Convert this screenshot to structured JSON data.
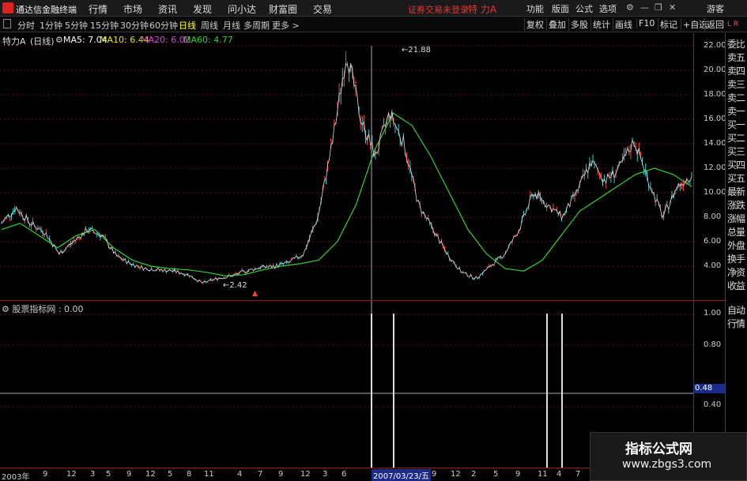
{
  "app": {
    "title": "通达信金融终端",
    "menus": [
      "行情",
      "市场",
      "资讯",
      "发现",
      "问小达",
      "财富圈",
      "交易"
    ],
    "login_status": "证券交易未登录",
    "stock_name": "特 力A",
    "right_menus": [
      "功能",
      "版面",
      "公式",
      "选项"
    ],
    "user": "游客"
  },
  "periods": [
    "分时",
    "1分钟",
    "5分钟",
    "15分钟",
    "30分钟",
    "60分钟",
    "日线",
    "周线",
    "月线",
    "多周期",
    "更多 >"
  ],
  "active_period": "日线",
  "toolbar": [
    "复权",
    "叠加",
    "多股",
    "统计",
    "画线",
    "F10",
    "标记",
    "+自选",
    "返回"
  ],
  "info": {
    "name": "特力A",
    "period": "(日线)",
    "ma5_label": "MA5: 7.04",
    "ma10_label": "MA10: 6.44",
    "ma20_label": "MA20: 6.02",
    "ma60_label": "MA60: 4.77"
  },
  "colors": {
    "ma5": "#ffffff",
    "ma10": "#e8e800",
    "ma20": "#e040e0",
    "ma60": "#30d030",
    "axis": "#9b1c1c",
    "candle_up": "#ff4444",
    "candle_down": "#33cccc"
  },
  "quote_panel": [
    "委比",
    "卖五",
    "卖四",
    "卖三",
    "卖二",
    "卖一",
    "买一",
    "买二",
    "买三",
    "买四",
    "买五",
    "最新",
    "涨跌",
    "涨幅",
    "总量",
    "外盘",
    "换手",
    "净资",
    "收益"
  ],
  "auto_quote": [
    "自动",
    "行情"
  ],
  "price_axis": [
    "22.00",
    "20.00",
    "18.00",
    "16.00",
    "14.00",
    "12.00",
    "10.00",
    "8.00",
    "6.00",
    "4.00"
  ],
  "indicator": {
    "label": "股票指标网 : 0.00",
    "axis": [
      "1.00",
      "0.80",
      "0.48",
      "0.40"
    ],
    "current": "0.48"
  },
  "x_axis": [
    "2003年",
    "9",
    "12",
    "3",
    "5",
    "9",
    "12",
    "5",
    "8",
    "11",
    "4",
    "7",
    "9",
    "12",
    "3",
    "6",
    "9",
    "12",
    "2",
    "2007/03/23/五",
    "5",
    "9",
    "11",
    "4",
    "7"
  ],
  "x_cursor": "2007/03/23/五",
  "annotations": {
    "high": "21.88",
    "low": "2.42"
  },
  "watermark": {
    "line1": "指标公式网",
    "line2": "www.zbgs3.com"
  },
  "chart_data": {
    "type": "line",
    "series": [
      {
        "name": "MA60",
        "values": [
          7.0,
          7.5,
          6.5,
          5.5,
          6.5,
          7.0,
          5.5,
          4.5,
          4.0,
          3.8,
          3.7,
          3.5,
          3.2,
          3.3,
          3.7,
          4.0,
          4.2,
          4.5,
          6.0,
          9.0,
          13.5,
          16.5,
          15.5,
          13.0,
          10.0,
          7.0,
          5.0,
          3.8,
          3.6,
          4.5,
          6.5,
          8.5,
          9.5,
          10.5,
          11.5,
          12.0,
          11.5,
          10.5
        ]
      },
      {
        "name": "",
        "values": [
          0,
          0,
          0,
          0,
          1,
          1,
          0,
          0,
          1,
          1
        ]
      }
    ],
    "ylim": [
      2,
      22
    ],
    "indicator_ylim": [
      0,
      1.1
    ]
  }
}
